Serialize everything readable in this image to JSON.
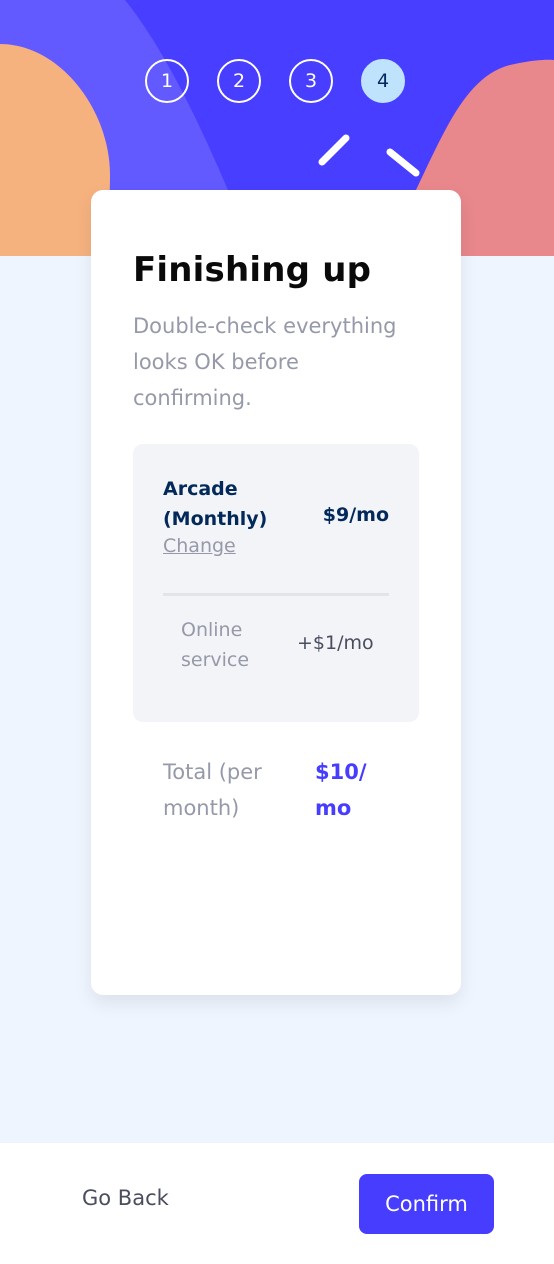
{
  "colors": {
    "primary": "#473dff",
    "hero_blue": "#483eff",
    "hero_orange": "#f5b27f",
    "hero_pink": "#e8878c",
    "step_active_bg": "#bfe2fd",
    "page_bg": "#eff5ff",
    "text_dark": "#02295a",
    "text_grey": "#9699a9"
  },
  "steps": [
    {
      "number": "1",
      "active": false
    },
    {
      "number": "2",
      "active": false
    },
    {
      "number": "3",
      "active": false
    },
    {
      "number": "4",
      "active": true
    }
  ],
  "summary": {
    "title": "Finishing up",
    "subtitle": "Double-check everything looks OK before confirming.",
    "plan": {
      "name": "Arcade (Monthly)",
      "change_label": "Change",
      "price": "$9/mo"
    },
    "addons": [
      {
        "name": "Online service",
        "price": "+$1/mo"
      }
    ],
    "total": {
      "label": "Total (per month)",
      "value": "$10/ mo"
    }
  },
  "footer": {
    "back_label": "Go Back",
    "confirm_label": "Confirm"
  }
}
